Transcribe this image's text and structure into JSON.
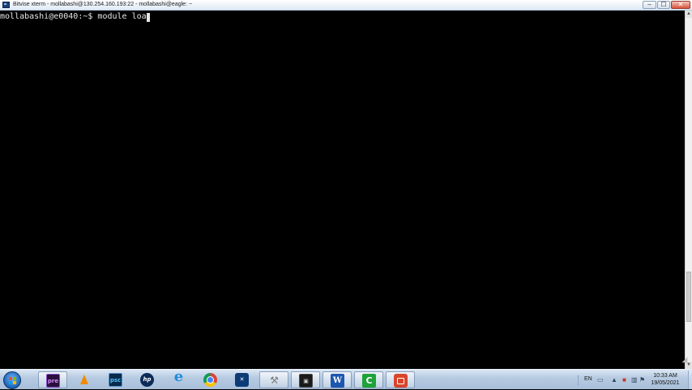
{
  "window": {
    "title": "Bitvise xterm - mollabashi@130.254.160.193:22 - mollabashi@eagle: ~",
    "controls": {
      "minimize": "–",
      "maximize": "☐",
      "close": "✕"
    }
  },
  "terminal": {
    "prompt": "mollabashi@e0040:~$ ",
    "command": "module loa"
  },
  "taskbar": {
    "apps": [
      {
        "name": "premiere-icon",
        "label": "pre",
        "active": true
      },
      {
        "name": "vlc-icon",
        "label": "",
        "active": false
      },
      {
        "name": "photoshop-icon",
        "label": "psc",
        "active": false
      },
      {
        "name": "hp-icon",
        "label": "hp",
        "active": false
      },
      {
        "name": "internet-explorer-icon",
        "label": "",
        "active": false
      },
      {
        "name": "chrome-icon",
        "label": "",
        "active": false
      },
      {
        "name": "shield-icon",
        "label": "✕",
        "active": false
      },
      {
        "name": "tools-icon",
        "label": "⚒",
        "active": true
      },
      {
        "name": "bitvise-icon",
        "label": "▣",
        "active": true
      },
      {
        "name": "word-icon",
        "label": "W",
        "active": true
      },
      {
        "name": "camtasia-icon",
        "label": "C",
        "active": true
      },
      {
        "name": "recorder-icon",
        "label": "",
        "active": true
      }
    ],
    "tray": {
      "language": "EN",
      "time": "10:33 AM",
      "date": "19/05/2021"
    }
  },
  "colors": {
    "terminal_bg": "#000000",
    "terminal_fg": "#e6e6e6",
    "taskbar": "#b7cbe2"
  }
}
